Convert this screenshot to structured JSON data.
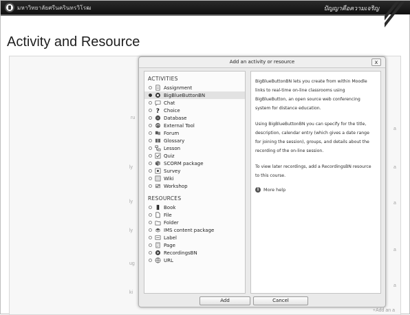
{
  "header": {
    "university_name": "มหาวิทยาลัยศรีนครินทรวิโรฒ",
    "motto": "ปัญญาคือความเจริญ"
  },
  "slide": {
    "title": "Activity and Resource"
  },
  "background": {
    "left_fragments": [
      "ru",
      "ly",
      "ly",
      "ly",
      "ug",
      "ki"
    ],
    "right_fragments": [
      "a",
      "a",
      "a",
      "a",
      "a"
    ],
    "bottom_link": "+Add an a"
  },
  "dialog": {
    "title": "Add an activity or resource",
    "close_label": "x",
    "activities_heading": "ACTIVITIES",
    "resources_heading": "RESOURCES",
    "selected": "BigBlueButtonBN",
    "activities": [
      {
        "label": "Assignment",
        "icon": "assignment-icon"
      },
      {
        "label": "BigBlueButtonBN",
        "icon": "bigbluebutton-icon"
      },
      {
        "label": "Chat",
        "icon": "chat-icon"
      },
      {
        "label": "Choice",
        "icon": "choice-icon"
      },
      {
        "label": "Database",
        "icon": "database-icon"
      },
      {
        "label": "External Tool",
        "icon": "external-tool-icon"
      },
      {
        "label": "Forum",
        "icon": "forum-icon"
      },
      {
        "label": "Glossary",
        "icon": "glossary-icon"
      },
      {
        "label": "Lesson",
        "icon": "lesson-icon"
      },
      {
        "label": "Quiz",
        "icon": "quiz-icon"
      },
      {
        "label": "SCORM package",
        "icon": "scorm-icon"
      },
      {
        "label": "Survey",
        "icon": "survey-icon"
      },
      {
        "label": "Wiki",
        "icon": "wiki-icon"
      },
      {
        "label": "Workshop",
        "icon": "workshop-icon"
      }
    ],
    "resources": [
      {
        "label": "Book",
        "icon": "book-icon"
      },
      {
        "label": "File",
        "icon": "file-icon"
      },
      {
        "label": "Folder",
        "icon": "folder-icon"
      },
      {
        "label": "IMS content package",
        "icon": "ims-package-icon"
      },
      {
        "label": "Label",
        "icon": "label-icon"
      },
      {
        "label": "Page",
        "icon": "page-icon"
      },
      {
        "label": "RecordingsBN",
        "icon": "recordings-icon"
      },
      {
        "label": "URL",
        "icon": "url-icon"
      }
    ],
    "help_paragraphs": [
      "BigBlueButtonBN lets you create from within Moodle links to real-time on-line classrooms using BigBlueButton, an open source web conferencing system for distance education.",
      "Using BigBlueButtonBN you can specify for the title, description, calendar entry (which gives a date range for joining the session), groups, and details about the recording of the on-line session.",
      "To view later recordings, add a RecordingsBN resource to this course."
    ],
    "more_help_label": "More help",
    "add_label": "Add",
    "cancel_label": "Cancel"
  }
}
